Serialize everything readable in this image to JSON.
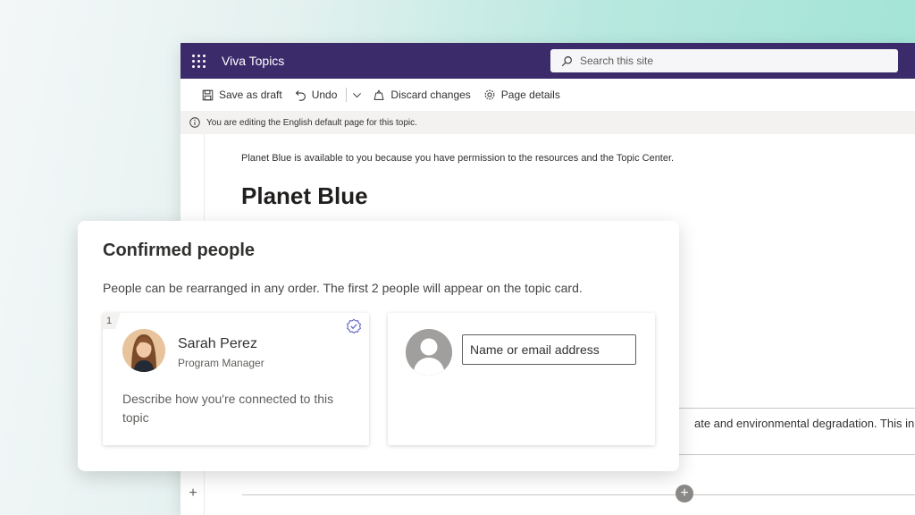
{
  "suitebar": {
    "app_title": "Viva Topics",
    "search_placeholder": "Search this site",
    "bg_color": "#3b2b6b"
  },
  "commands": {
    "save_draft": "Save as draft",
    "undo": "Undo",
    "discard": "Discard changes",
    "page_details": "Page details"
  },
  "info_message": "You are editing the English default page for this topic.",
  "page": {
    "permission_text": "Planet Blue is available to you because you have permission to the resources and the Topic Center.",
    "title": "Planet Blue",
    "body_snippet": "ate and environmental degradation. This initia"
  },
  "confirmed_people": {
    "title": "Confirmed people",
    "description": "People can be rearranged in any order. The first 2 people will appear on the topic card.",
    "cards": [
      {
        "order": "1",
        "name": "Sarah Perez",
        "job_title": "Program Manager",
        "connection_prompt": "Describe how you're connected to this topic"
      }
    ],
    "add_person_placeholder": "Name or email address"
  },
  "icons": {
    "waffle": "waffle-icon",
    "search": "search-icon",
    "save": "save-icon",
    "undo": "undo-icon",
    "chevron": "chevron-down-icon",
    "discard": "discard-icon",
    "settings": "gear-icon",
    "info": "info-icon",
    "verified": "verified-check-icon",
    "add": "plus-icon"
  }
}
